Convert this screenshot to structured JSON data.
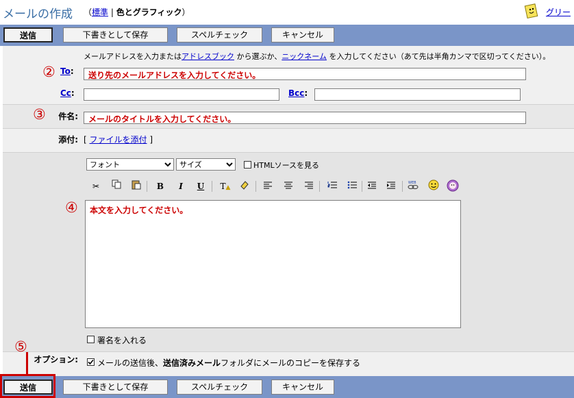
{
  "header": {
    "title": "メールの作成",
    "paren_open": "（",
    "view_standard": "標準",
    "divider": " | ",
    "view_rich": "色とグラフィック",
    "paren_close": "）",
    "greeting_link": "グリー"
  },
  "toolbar": {
    "send": "送信",
    "save_draft": "下書きとして保存",
    "spellcheck": "スペルチェック",
    "cancel": "キャンセル"
  },
  "instruction": {
    "pre": "メールアドレスを入力または",
    "address_book": "アドレスブック",
    "mid": " から選ぶか、",
    "nickname": "ニックネーム",
    "post": " を入力してください（あて先は半角カンマで区切ってください）。"
  },
  "fields": {
    "to_label": "To",
    "to_value": "送り先のメールアドレスを入力してください。",
    "cc_label": "Cc",
    "bcc_label": "Bcc",
    "subject_label": "件名:",
    "subject_value": "メールのタイトルを入力してください。",
    "attach_label": "添付:",
    "attach_bracket_open": "[",
    "attach_link": "ファイルを添付",
    "attach_bracket_close": "]",
    "colon": ":"
  },
  "editor": {
    "font_select": "フォント",
    "size_select": "サイズ",
    "html_source": "HTMLソースを見る",
    "body_value": "本文を入力してください。",
    "signature": "署名を入れる"
  },
  "options": {
    "label": "オプション:",
    "save_copy_pre": "メールの送信後、",
    "save_copy_bold": "送信済みメール",
    "save_copy_post": "フォルダにメールのコピーを保存する"
  },
  "annotations": {
    "n2": "②",
    "n3": "③",
    "n4": "④",
    "n5": "⑤"
  },
  "colors": {
    "toolbar": "#7a95c8",
    "annotation": "#cc0000",
    "title": "#3a6ea5"
  },
  "icons": [
    "cut-icon",
    "copy-icon",
    "paste-icon",
    "bold-icon",
    "italic-icon",
    "underline-icon",
    "text-color-icon",
    "highlight-icon",
    "align-left-icon",
    "align-center-icon",
    "align-right-icon",
    "ordered-list-icon",
    "unordered-list-icon",
    "outdent-icon",
    "indent-icon",
    "link-icon",
    "emoticon-icon",
    "special-emoticon-icon"
  ]
}
